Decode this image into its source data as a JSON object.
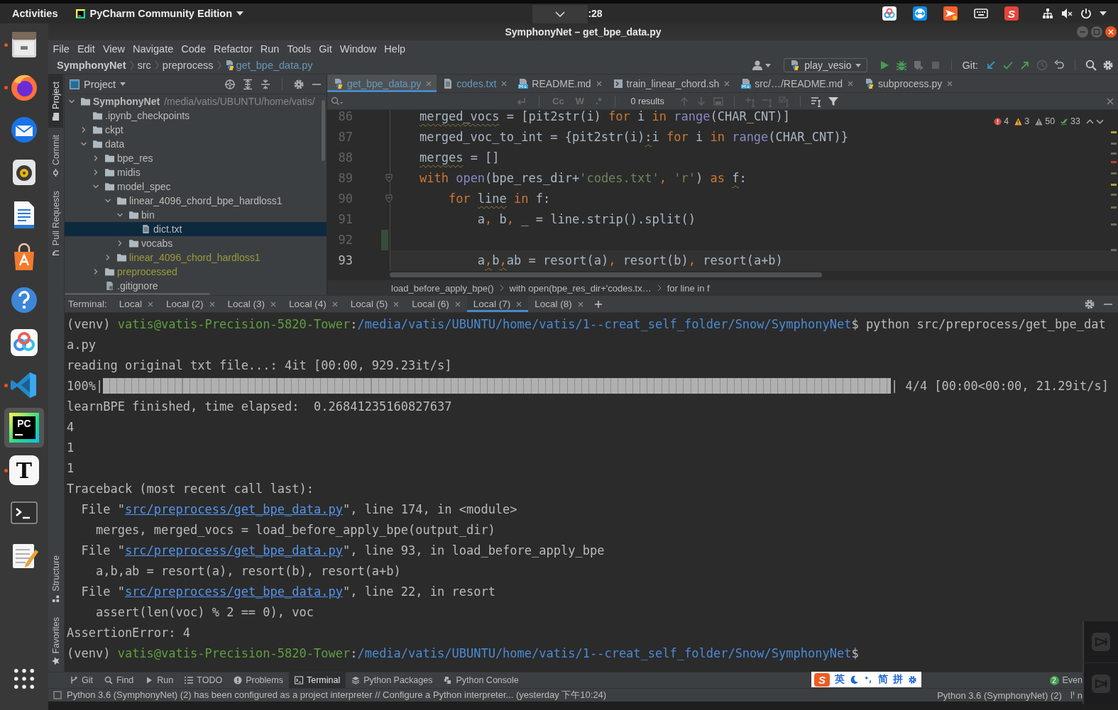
{
  "top_bar": {
    "activities": "Activities",
    "app_menu": "PyCharm Community Edition",
    "clock": ":28",
    "tray_logo_letter": "S"
  },
  "dock": [
    {
      "kind": "drawer",
      "running": true,
      "selected": false
    },
    {
      "kind": "globe",
      "running": true,
      "selected": false
    },
    {
      "kind": "mail",
      "running": false,
      "selected": false
    },
    {
      "kind": "speaker",
      "running": false,
      "selected": false
    },
    {
      "kind": "document",
      "running": false,
      "selected": false
    },
    {
      "kind": "bag",
      "running": false,
      "selected": false
    },
    {
      "kind": "help",
      "running": false,
      "selected": false
    },
    {
      "kind": "rings",
      "running": false,
      "selected": false
    },
    {
      "kind": "ribbon",
      "running": true,
      "selected": false
    },
    {
      "kind": "ide",
      "label": "PC",
      "running": false,
      "selected": true
    },
    {
      "kind": "letter",
      "label": "T",
      "running": true,
      "selected": false
    },
    {
      "kind": "terminal",
      "running": false,
      "selected": false
    },
    {
      "kind": "notepad",
      "running": false,
      "selected": false
    }
  ],
  "window": {
    "title": "SymphonyNet – get_bpe_data.py"
  },
  "menu": [
    "File",
    "Edit",
    "View",
    "Navigate",
    "Code",
    "Refactor",
    "Run",
    "Tools",
    "Git",
    "Window",
    "Help"
  ],
  "navigation": {
    "breadcrumbs": [
      {
        "label": "SymphonyNet",
        "kind": "project"
      },
      {
        "label": "src",
        "kind": "folder"
      },
      {
        "label": "preprocess",
        "kind": "folder"
      },
      {
        "label": "get_bpe_data.py",
        "kind": "python-file"
      }
    ],
    "run_config": "play_vesio",
    "git_label": "Git:"
  },
  "tool_strip": {
    "top": [
      {
        "label": "Project",
        "kind": "project",
        "selected": true
      },
      {
        "label": "Commit",
        "kind": "commit",
        "selected": false
      },
      {
        "label": "Pull Requests",
        "kind": "pull-requests",
        "selected": false
      }
    ],
    "bottom": [
      {
        "label": "Structure",
        "kind": "structure",
        "selected": false
      },
      {
        "label": "Favorites",
        "kind": "favorites",
        "selected": false
      }
    ]
  },
  "project": {
    "title": "Project",
    "tree": [
      {
        "label": "SymphonyNet",
        "path": "/media/vatis/UBUNTU/home/vatis/",
        "kind": "folder",
        "expanded": true,
        "selected": false,
        "ignored": false,
        "children": [
          {
            "label": ".ipynb_checkpoints",
            "kind": "empty-folder",
            "selected": false,
            "ignored": false
          },
          {
            "label": "ckpt",
            "kind": "folder",
            "expanded": false,
            "selected": false,
            "ignored": false
          },
          {
            "label": "data",
            "kind": "folder",
            "expanded": true,
            "selected": false,
            "ignored": false,
            "children": [
              {
                "label": "bpe_res",
                "kind": "folder",
                "expanded": false,
                "selected": false,
                "ignored": false
              },
              {
                "label": "midis",
                "kind": "folder",
                "expanded": false,
                "selected": false,
                "ignored": false
              },
              {
                "label": "model_spec",
                "kind": "folder",
                "expanded": true,
                "selected": false,
                "ignored": false,
                "children": [
                  {
                    "label": "linear_4096_chord_bpe_hardloss1",
                    "kind": "folder",
                    "expanded": true,
                    "selected": false,
                    "ignored": false,
                    "children": [
                      {
                        "label": "bin",
                        "kind": "folder",
                        "expanded": true,
                        "selected": false,
                        "ignored": false,
                        "children": [
                          {
                            "label": "dict.txt",
                            "kind": "file",
                            "selected": true,
                            "ignored": false
                          }
                        ]
                      },
                      {
                        "label": "vocabs",
                        "kind": "folder",
                        "expanded": false,
                        "selected": false,
                        "ignored": false
                      }
                    ]
                  },
                  {
                    "label": "linear_4096_chord_hardloss1",
                    "kind": "folder",
                    "expanded": false,
                    "selected": false,
                    "ignored": true
                  }
                ]
              },
              {
                "label": "preprocessed",
                "kind": "folder",
                "expanded": false,
                "selected": false,
                "ignored": true
              },
              {
                "label": ".gitignore",
                "kind": "git-file",
                "selected": false,
                "ignored": false
              }
            ]
          }
        ]
      }
    ]
  },
  "editor": {
    "tabs": [
      {
        "label": "get_bpe_data.py",
        "kind": "python",
        "selected": true,
        "modified": true
      },
      {
        "label": "codes.txt",
        "kind": "text",
        "selected": false,
        "modified": true
      },
      {
        "label": "README.md",
        "kind": "markdown",
        "selected": false,
        "modified": false
      },
      {
        "label": "train_linear_chord.sh",
        "kind": "shell",
        "selected": false,
        "modified": false
      },
      {
        "label": "src/…/README.md",
        "kind": "markdown",
        "selected": false,
        "modified": false
      },
      {
        "label": "subprocess.py",
        "kind": "python",
        "selected": false,
        "modified": false
      }
    ],
    "search": {
      "options": [
        "Cc",
        "W",
        ".*"
      ],
      "results": "0 results"
    },
    "inspections": {
      "errors": "4",
      "warnings": "3",
      "weak_warnings": "50",
      "typos": "33"
    },
    "lines": [
      {
        "number": "86",
        "current": false,
        "changed": false,
        "foldable": false,
        "tokens": [
          {
            "text": "    merged_vocs",
            "kind": "flagged"
          },
          {
            "text": " = [pit2str(i) ",
            "kind": "plain"
          },
          {
            "text": "for",
            "kind": "keyword"
          },
          {
            "text": " i ",
            "kind": "plain"
          },
          {
            "text": "in",
            "kind": "keyword"
          },
          {
            "text": " range",
            "kind": "builtin"
          },
          {
            "text": "(CHAR_CNT)]",
            "kind": "plain"
          }
        ]
      },
      {
        "number": "87",
        "current": false,
        "changed": false,
        "foldable": false,
        "tokens": [
          {
            "text": "    merged_voc_to_int = {pit2str(i)",
            "kind": "plain"
          },
          {
            "text": ":",
            "kind": "flagged"
          },
          {
            "text": "i ",
            "kind": "plain"
          },
          {
            "text": "for",
            "kind": "keyword"
          },
          {
            "text": " i ",
            "kind": "plain"
          },
          {
            "text": "in",
            "kind": "keyword"
          },
          {
            "text": " range",
            "kind": "builtin"
          },
          {
            "text": "(CHAR_CNT)}",
            "kind": "plain"
          }
        ]
      },
      {
        "number": "88",
        "current": false,
        "changed": false,
        "foldable": false,
        "tokens": [
          {
            "text": "    merges",
            "kind": "flagged"
          },
          {
            "text": " = []",
            "kind": "plain"
          }
        ]
      },
      {
        "number": "89",
        "current": false,
        "changed": false,
        "foldable": true,
        "tokens": [
          {
            "text": "    with",
            "kind": "keyword"
          },
          {
            "text": " open",
            "kind": "builtin"
          },
          {
            "text": "(bpe_res_dir+",
            "kind": "plain"
          },
          {
            "text": "'codes.txt'",
            "kind": "string"
          },
          {
            "text": ", ",
            "kind": "keyword"
          },
          {
            "text": "'r'",
            "kind": "string"
          },
          {
            "text": ") ",
            "kind": "plain"
          },
          {
            "text": "as",
            "kind": "keyword"
          },
          {
            "text": " f",
            "kind": "flagged"
          },
          {
            "text": ":",
            "kind": "plain"
          }
        ]
      },
      {
        "number": "90",
        "current": false,
        "changed": false,
        "foldable": true,
        "tokens": [
          {
            "text": "        for",
            "kind": "keyword"
          },
          {
            "text": " line",
            "kind": "flagged"
          },
          {
            "text": " in",
            "kind": "keyword"
          },
          {
            "text": " f:",
            "kind": "plain"
          }
        ]
      },
      {
        "number": "91",
        "current": false,
        "changed": false,
        "foldable": false,
        "tokens": [
          {
            "text": "            a",
            "kind": "plain"
          },
          {
            "text": ",",
            "kind": "keyword"
          },
          {
            "text": " b",
            "kind": "plain"
          },
          {
            "text": ",",
            "kind": "keyword"
          },
          {
            "text": " _ = line.strip().split()",
            "kind": "plain"
          }
        ]
      },
      {
        "number": "92",
        "current": false,
        "changed": true,
        "foldable": false
      },
      {
        "number": "93",
        "current": true,
        "changed": false,
        "foldable": false,
        "tokens": [
          {
            "text": "            a",
            "kind": "plain"
          },
          {
            "text": ",",
            "kind": "flagged-keyword"
          },
          {
            "text": "b",
            "kind": "plain"
          },
          {
            "text": ",",
            "kind": "flagged-keyword"
          },
          {
            "text": "ab = resort(a)",
            "kind": "plain"
          },
          {
            "text": ",",
            "kind": "keyword"
          },
          {
            "text": " resort(b)",
            "kind": "plain"
          },
          {
            "text": ",",
            "kind": "keyword"
          },
          {
            "text": " resort(a+b)",
            "kind": "plain"
          }
        ]
      }
    ],
    "breadcrumbs": [
      "load_before_apply_bpe()",
      "with open(bpe_res_dir+'codes.tx…",
      "for line in f"
    ]
  },
  "terminal": {
    "label": "Terminal:",
    "tabs": [
      {
        "label": "Local",
        "selected": false
      },
      {
        "label": "Local (2)",
        "selected": false
      },
      {
        "label": "Local (3)",
        "selected": false
      },
      {
        "label": "Local (4)",
        "selected": false
      },
      {
        "label": "Local (5)",
        "selected": false
      },
      {
        "label": "Local (6)",
        "selected": false
      },
      {
        "label": "Local (7)",
        "selected": true
      },
      {
        "label": "Local (8)",
        "selected": false
      }
    ],
    "lines": [
      [
        {
          "text": "(venv) ",
          "kind": "plain"
        },
        {
          "text": "vatis@vatis-Precision-5820-Tower",
          "kind": "user"
        },
        {
          "text": ":",
          "kind": "plain"
        },
        {
          "text": "/media/vatis/UBUNTU/home/vatis/1--creat_self_folder/Snow/SymphonyNet",
          "kind": "path"
        },
        {
          "text": "$ python src/preprocess/get_bpe_dat",
          "kind": "plain"
        }
      ],
      [
        {
          "text": "a.py",
          "kind": "plain"
        }
      ],
      [
        {
          "text": "reading original txt file...: 4it [00:00, 929.23it/s]",
          "kind": "plain"
        }
      ],
      [
        {
          "text": "100%|",
          "kind": "plain"
        },
        {
          "kind": "progress",
          "level": 1
        },
        {
          "text": "| 4/4 [00:00<00:00, 21.29it/s]",
          "kind": "plain"
        }
      ],
      [
        {
          "text": "learnBPE finished, time elapsed:  0.26841235160827637",
          "kind": "plain"
        }
      ],
      [
        {
          "text": "4",
          "kind": "plain"
        }
      ],
      [
        {
          "text": "1",
          "kind": "plain"
        }
      ],
      [
        {
          "text": "1",
          "kind": "plain"
        }
      ],
      [
        {
          "text": "Traceback (most recent call last):",
          "kind": "plain"
        }
      ],
      [
        {
          "text": "  File \"",
          "kind": "plain"
        },
        {
          "text": "src/preprocess/get_bpe_data.py",
          "kind": "link"
        },
        {
          "text": "\", line 174, in <module>",
          "kind": "plain"
        }
      ],
      [
        {
          "text": "    merges, merged_vocs = load_before_apply_bpe(output_dir)",
          "kind": "plain"
        }
      ],
      [
        {
          "text": "  File \"",
          "kind": "plain"
        },
        {
          "text": "src/preprocess/get_bpe_data.py",
          "kind": "link"
        },
        {
          "text": "\", line 93, in load_before_apply_bpe",
          "kind": "plain"
        }
      ],
      [
        {
          "text": "    a,b,ab = resort(a), resort(b), resort(a+b)",
          "kind": "plain"
        }
      ],
      [
        {
          "text": "  File \"",
          "kind": "plain"
        },
        {
          "text": "src/preprocess/get_bpe_data.py",
          "kind": "link"
        },
        {
          "text": "\", line 22, in resort",
          "kind": "plain"
        }
      ],
      [
        {
          "text": "    assert(len(voc) % 2 == 0), voc",
          "kind": "plain"
        }
      ],
      [
        {
          "text": "AssertionError: 4",
          "kind": "plain"
        }
      ],
      [
        {
          "text": "(venv) ",
          "kind": "plain"
        },
        {
          "text": "vatis@vatis-Precision-5820-Tower",
          "kind": "user"
        },
        {
          "text": ":",
          "kind": "plain"
        },
        {
          "text": "/media/vatis/UBUNTU/home/vatis/1--creat_self_folder/Snow/SymphonyNet",
          "kind": "path"
        },
        {
          "text": "$",
          "kind": "plain"
        }
      ]
    ]
  },
  "tool_windows": {
    "items": [
      {
        "label": "Git",
        "kind": "git",
        "selected": false
      },
      {
        "label": "Find",
        "kind": "find",
        "selected": false
      },
      {
        "label": "Run",
        "kind": "run",
        "selected": false
      },
      {
        "label": "TODO",
        "kind": "todo",
        "selected": false
      },
      {
        "label": "Problems",
        "kind": "problems",
        "selected": false
      },
      {
        "label": "Terminal",
        "kind": "terminal",
        "selected": true
      },
      {
        "label": "Python Packages",
        "kind": "packages",
        "selected": false
      },
      {
        "label": "Python Console",
        "kind": "console",
        "selected": false
      }
    ],
    "event_log": {
      "label": "Even",
      "count": "2"
    }
  },
  "status_bar": {
    "message": "Python 3.6 (SymphonyNet) (2) has been configured as a project interpreter // Configure a Python interpreter... (yesterday 下午10:24)",
    "interpreter": "Python 3.6 (SymphonyNet) (2)",
    "branch": "n"
  },
  "input_method_bar": {
    "logo": "S",
    "items": [
      {
        "kind": "text",
        "label": "英"
      },
      {
        "kind": "moon"
      },
      {
        "kind": "punctuation"
      },
      {
        "kind": "text",
        "label": "简"
      },
      {
        "kind": "text",
        "label": "拼"
      },
      {
        "kind": "gear"
      }
    ]
  }
}
